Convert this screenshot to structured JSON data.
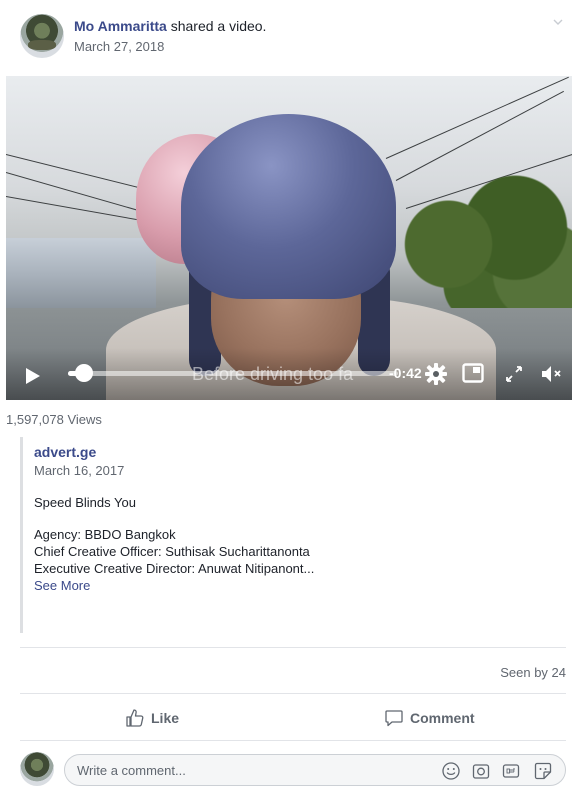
{
  "post": {
    "author_name": "Mo Ammaritta",
    "action_text": " shared a video.",
    "date": "March 27, 2018"
  },
  "video": {
    "subtitle": "Before driving too fa",
    "time_remaining": "-0:42",
    "progress": 0.02
  },
  "views": "1,597,078 Views",
  "shared": {
    "source_name": "advert.ge",
    "source_date": "March 16, 2017",
    "title": "Speed Blinds You",
    "lines": [
      "Agency: BBDO Bangkok",
      "Chief Creative Officer: Suthisak Sucharittanonta",
      "Executive Creative Director: Anuwat Nitipanont..."
    ],
    "see_more": "See More"
  },
  "seen_by": "Seen by 24",
  "actions": {
    "like": "Like",
    "comment": "Comment"
  },
  "composer": {
    "placeholder": "Write a comment..."
  },
  "colors": {
    "link": "#3b4a8a",
    "muted": "#616770",
    "divider": "#e2e4e8"
  }
}
